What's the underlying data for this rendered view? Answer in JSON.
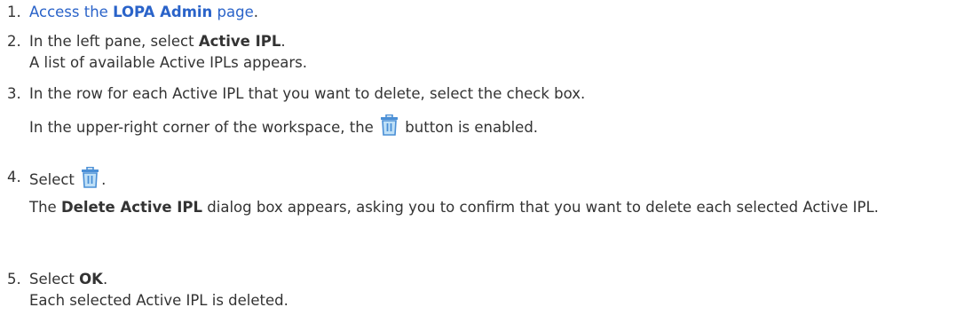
{
  "steps": [
    {
      "number": "1.",
      "link_pre": "Access the ",
      "link_bold": "LOPA Admin",
      "link_post": " page",
      "end": "."
    },
    {
      "number": "2.",
      "pre": "In the left pane, select ",
      "bold": "Active IPL",
      "end": ".",
      "result": "A list of available Active IPLs appears."
    },
    {
      "number": "3.",
      "text": "In the row for each Active IPL that you want to delete, select the check box.",
      "result_pre": "In the upper-right corner of the workspace, the ",
      "result_post": " button is enabled.",
      "icon": "trash-icon"
    },
    {
      "number": "4.",
      "pre": "Select ",
      "end": ".",
      "icon": "trash-icon",
      "result_bold": "Delete Active IPL",
      "result_rest": " dialog box appears, asking you to confirm that you want to delete each selected Active IPL.",
      "result_lead": "The "
    },
    {
      "number": "5.",
      "pre": "Select ",
      "bold": "OK",
      "end": ".",
      "result": "Each selected Active IPL is deleted."
    }
  ],
  "colors": {
    "link": "#2a63c9",
    "text": "#333333",
    "icon": "#4a8fd6"
  }
}
